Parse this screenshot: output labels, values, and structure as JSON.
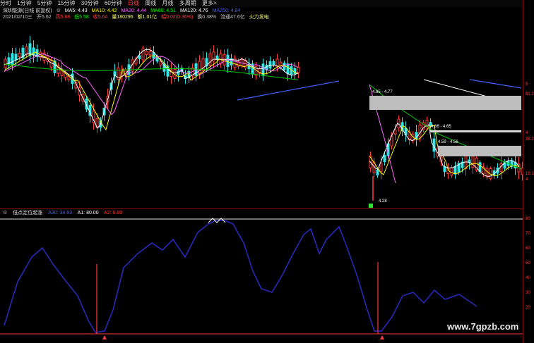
{
  "toolbar": {
    "items": [
      "分时",
      "1分钟",
      "5分钟",
      "15分钟",
      "30分钟",
      "60分钟",
      "日线",
      "周线",
      "月线",
      "多周期",
      "更多>"
    ],
    "active_index": 6
  },
  "stock": {
    "name": "深圳能源(日线 前复权)",
    "ma": [
      {
        "label": "MA5: 4.43",
        "color": "#ffffff"
      },
      {
        "label": "MA10: 4.42",
        "color": "#ffff00"
      },
      {
        "label": "MA20: 4.44",
        "color": "#ff66ff"
      },
      {
        "label": "MA60: 4.51",
        "color": "#00ff00"
      },
      {
        "label": "MA120: 4.76",
        "color": "#ffffff"
      },
      {
        "label": "MA250: 4.84",
        "color": "#4060ff"
      }
    ],
    "row2": [
      {
        "label": "2021/02/10三",
        "color": "#c8c8c8"
      },
      {
        "label": "开5.62",
        "color": "#c8c8c8"
      },
      {
        "label": "高5.68",
        "color": "#ff4040"
      },
      {
        "label": "低5.58",
        "color": "#00ff00"
      },
      {
        "label": "收5.64",
        "color": "#ff4040"
      },
      {
        "label": "量180296",
        "color": "#ffff66"
      },
      {
        "label": "额1.01亿",
        "color": "#ffff66"
      },
      {
        "label": "幅0.02(0.36%)",
        "color": "#ff4040"
      },
      {
        "label": "换0.38%",
        "color": "#c8c8c8"
      },
      {
        "label": "流通47.6亿",
        "color": "#c8c8c8"
      },
      {
        "label": "火力发电",
        "color": "#ffff66"
      }
    ]
  },
  "zones": [
    {
      "label": "4.85 - 4.77"
    },
    {
      "label": "4.66 - 4.65"
    },
    {
      "label": "4.59 - 4.56"
    },
    {
      "label": "4.28"
    }
  ],
  "indicator": {
    "title": "低点定位起涨",
    "values": [
      {
        "label": "A30: 34.93",
        "color": "#4060ff"
      },
      {
        "label": "A1: 80.00",
        "color": "#ffffff"
      },
      {
        "label": "A2: 0.00",
        "color": "#ff3b3b"
      }
    ]
  },
  "axis_top": [
    "5",
    "81.2",
    "4",
    "38.2",
    "19.1",
    "4"
  ],
  "axis_bottom": [
    "80",
    "70",
    "60",
    "50",
    "40",
    "30",
    "20"
  ],
  "watermark": "www.7gpzb.com",
  "colors": {
    "up": "#ff3b3b",
    "down": "#2ee6e6",
    "curve": "#2828b8"
  }
}
